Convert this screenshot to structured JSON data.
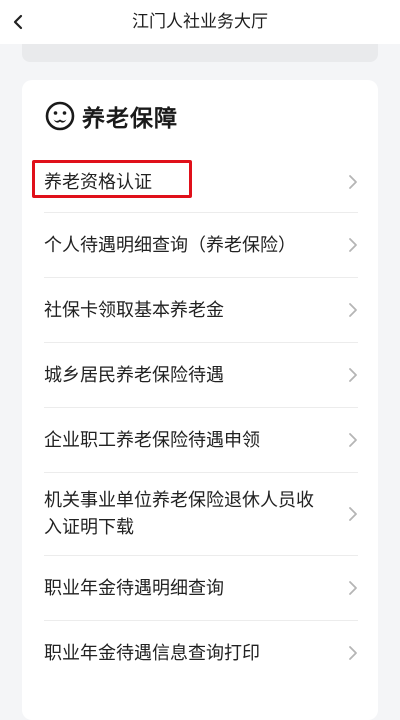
{
  "header": {
    "title": "江门人社业务大厅"
  },
  "section": {
    "title": "养老保障",
    "icon": "face-mustache-icon"
  },
  "items": [
    {
      "label": "养老资格认证"
    },
    {
      "label": "个人待遇明细查询（养老保险）"
    },
    {
      "label": "社保卡领取基本养老金"
    },
    {
      "label": "城乡居民养老保险待遇"
    },
    {
      "label": "企业职工养老保险待遇申领"
    },
    {
      "label": "机关事业单位养老保险退休人员收入证明下载"
    },
    {
      "label": "职业年金待遇明细查询"
    },
    {
      "label": "职业年金待遇信息查询打印"
    }
  ],
  "colors": {
    "highlight": "#e0101a",
    "background": "#f4f5f7"
  }
}
